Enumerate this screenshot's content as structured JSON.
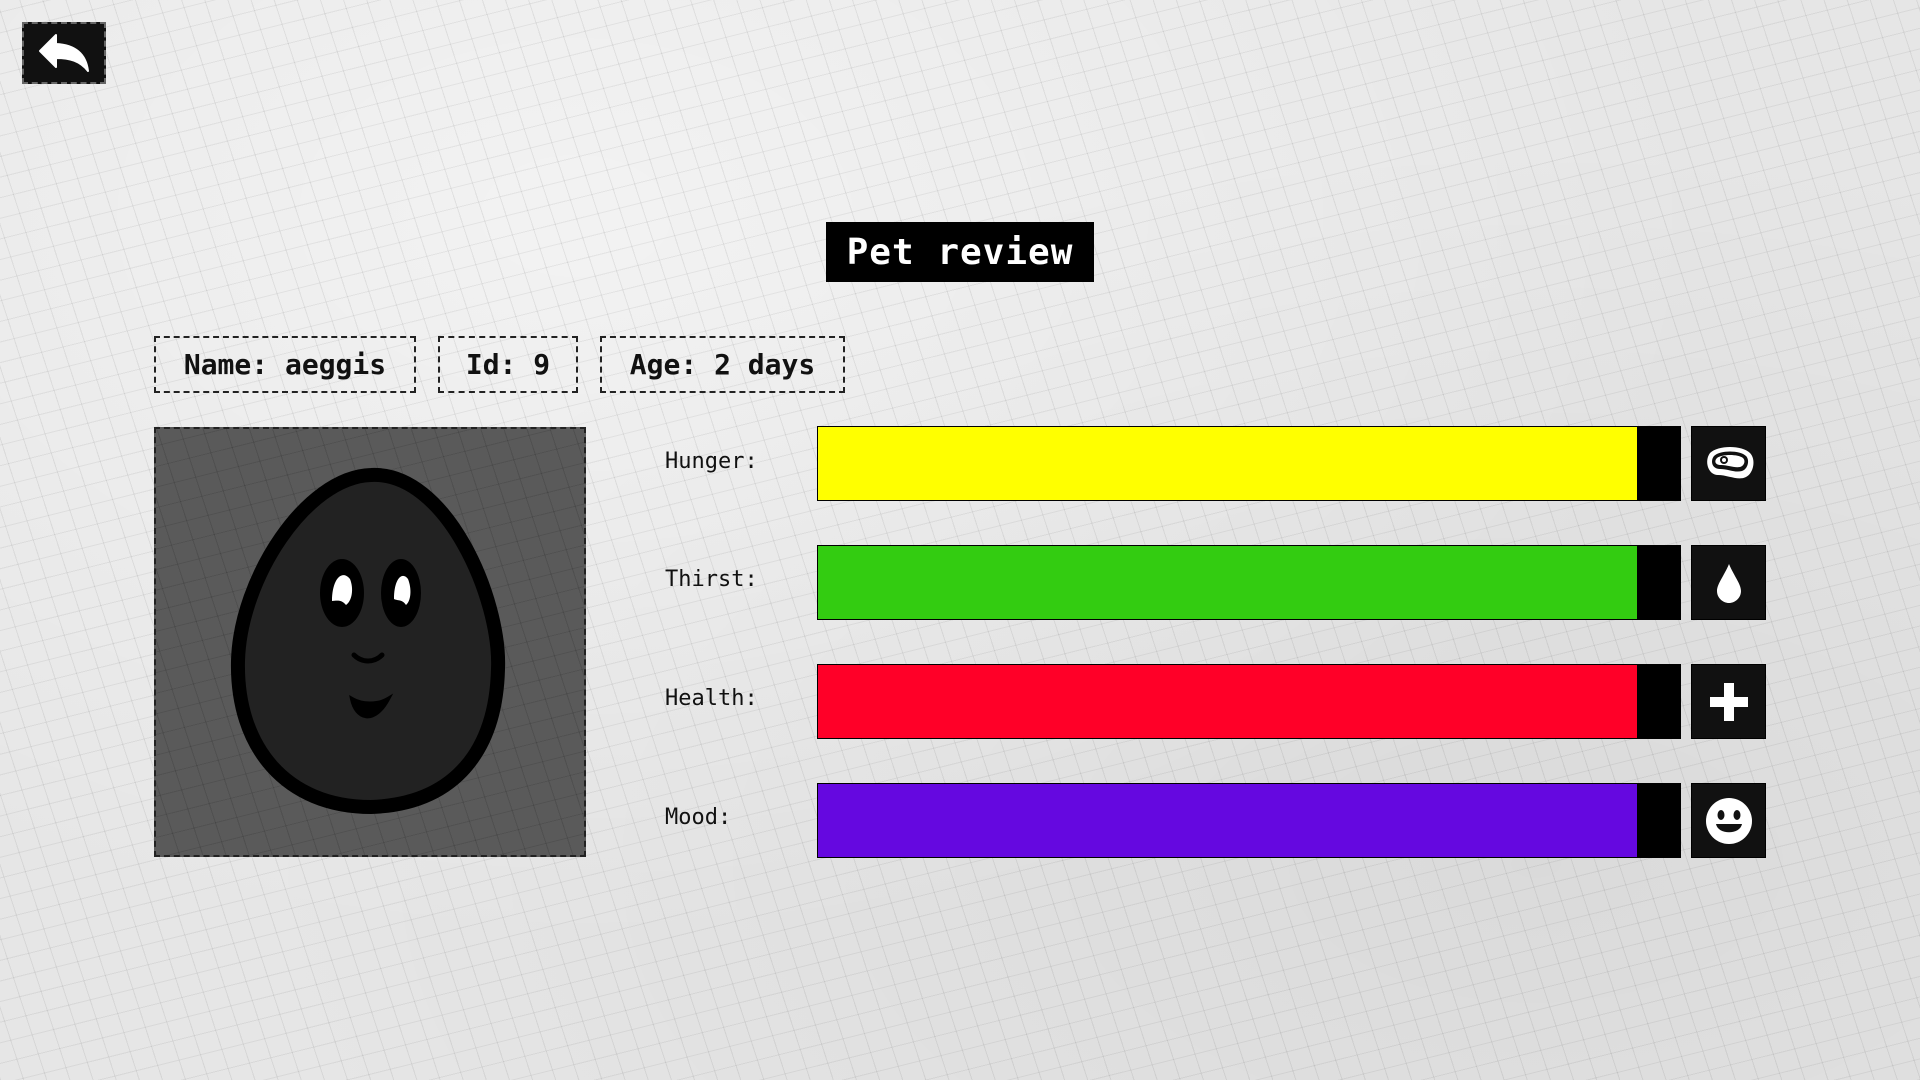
{
  "header": {
    "back_icon": "back-arrow-icon",
    "title": "Pet review"
  },
  "pet": {
    "name_text": "Name: aeggis",
    "id_text": "Id: 9",
    "age_text": "Age: 2 days"
  },
  "stats": [
    {
      "label": "Hunger:",
      "level": 0.95,
      "color": "#ffff00",
      "icon": "meat-icon"
    },
    {
      "label": "Thirst:",
      "level": 0.95,
      "color": "#33cc11",
      "icon": "water-drop-icon"
    },
    {
      "label": "Health:",
      "level": 0.95,
      "color": "#ff0028",
      "icon": "plus-icon"
    },
    {
      "label": "Mood:",
      "level": 0.95,
      "color": "#6508e0",
      "icon": "smiley-icon"
    }
  ]
}
